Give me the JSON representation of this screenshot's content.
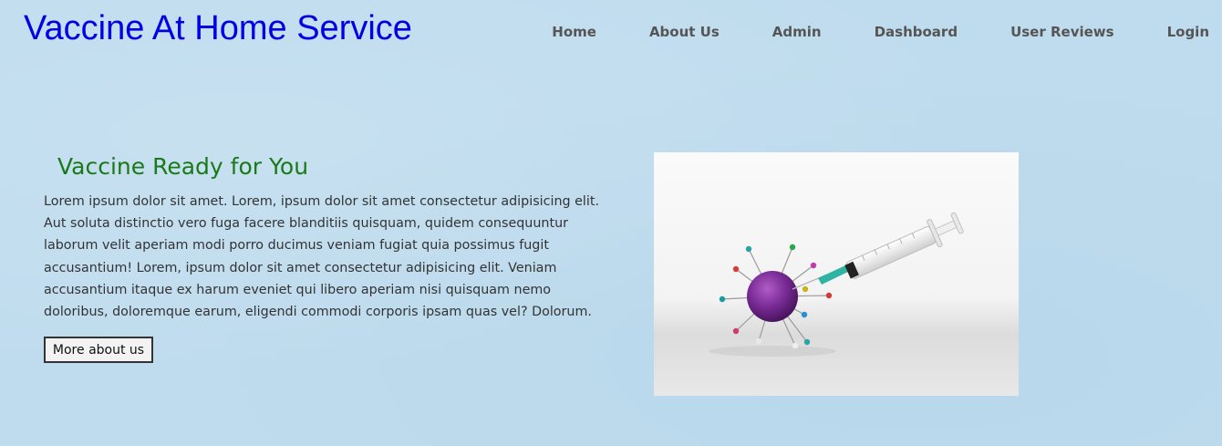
{
  "header": {
    "brand": "Vaccine At Home Service",
    "nav": [
      "Home",
      "About Us",
      "Admin",
      "Dashboard",
      "User Reviews",
      "Login"
    ]
  },
  "hero": {
    "title": "Vaccine Ready for You",
    "body": "Lorem ipsum dolor sit amet. Lorem, ipsum dolor sit amet consectetur adipisicing elit. Aut soluta distinctio vero fuga facere blanditiis quisquam, quidem consequuntur laborum velit aperiam modi porro ducimus veniam fugiat quia possimus fugit accusantium! Lorem, ipsum dolor sit amet consectetur adipisicing elit. Veniam accusantium itaque ex harum eveniet qui libero aperiam nisi quisquam nemo doloribus, doloremque earum, eligendi commodi corporis ipsam quas vel? Dolorum.",
    "button_label": "More about us"
  },
  "colors": {
    "background": "#bfdcee",
    "brand": "#0000e6",
    "hero_title": "#1a7a1a",
    "nav": "#555555"
  },
  "icons": {
    "hero_image": "virus-with-syringe-illustration"
  }
}
